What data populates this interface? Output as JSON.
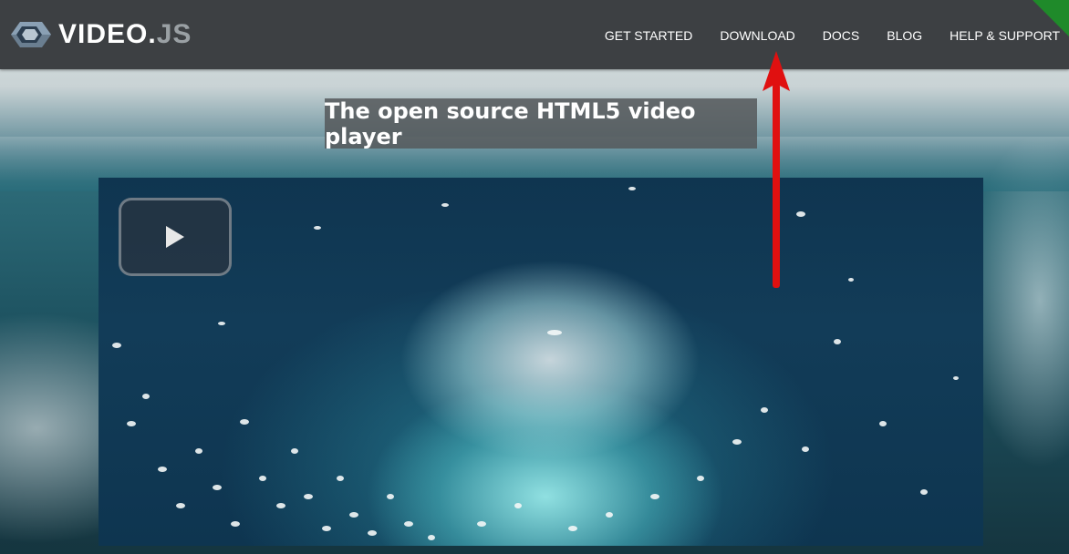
{
  "app": {
    "logo_text": "VIDEO",
    "logo_dot": ".",
    "logo_suffix": "JS"
  },
  "nav": {
    "items": [
      {
        "label": "GET STARTED"
      },
      {
        "label": "DOWNLOAD"
      },
      {
        "label": "DOCS"
      },
      {
        "label": "BLOG"
      },
      {
        "label": "HELP & SUPPORT"
      }
    ]
  },
  "hero": {
    "tagline": "The open source HTML5 video player"
  },
  "video": {
    "play_icon": "play-icon"
  },
  "annotation": {
    "icon": "red-arrow-up-icon",
    "color": "#e01010",
    "points_to": "DOWNLOAD"
  },
  "colors": {
    "header_bg": "#3d4043",
    "corner_flag": "#1f8a2a",
    "arrow": "#e01010"
  }
}
